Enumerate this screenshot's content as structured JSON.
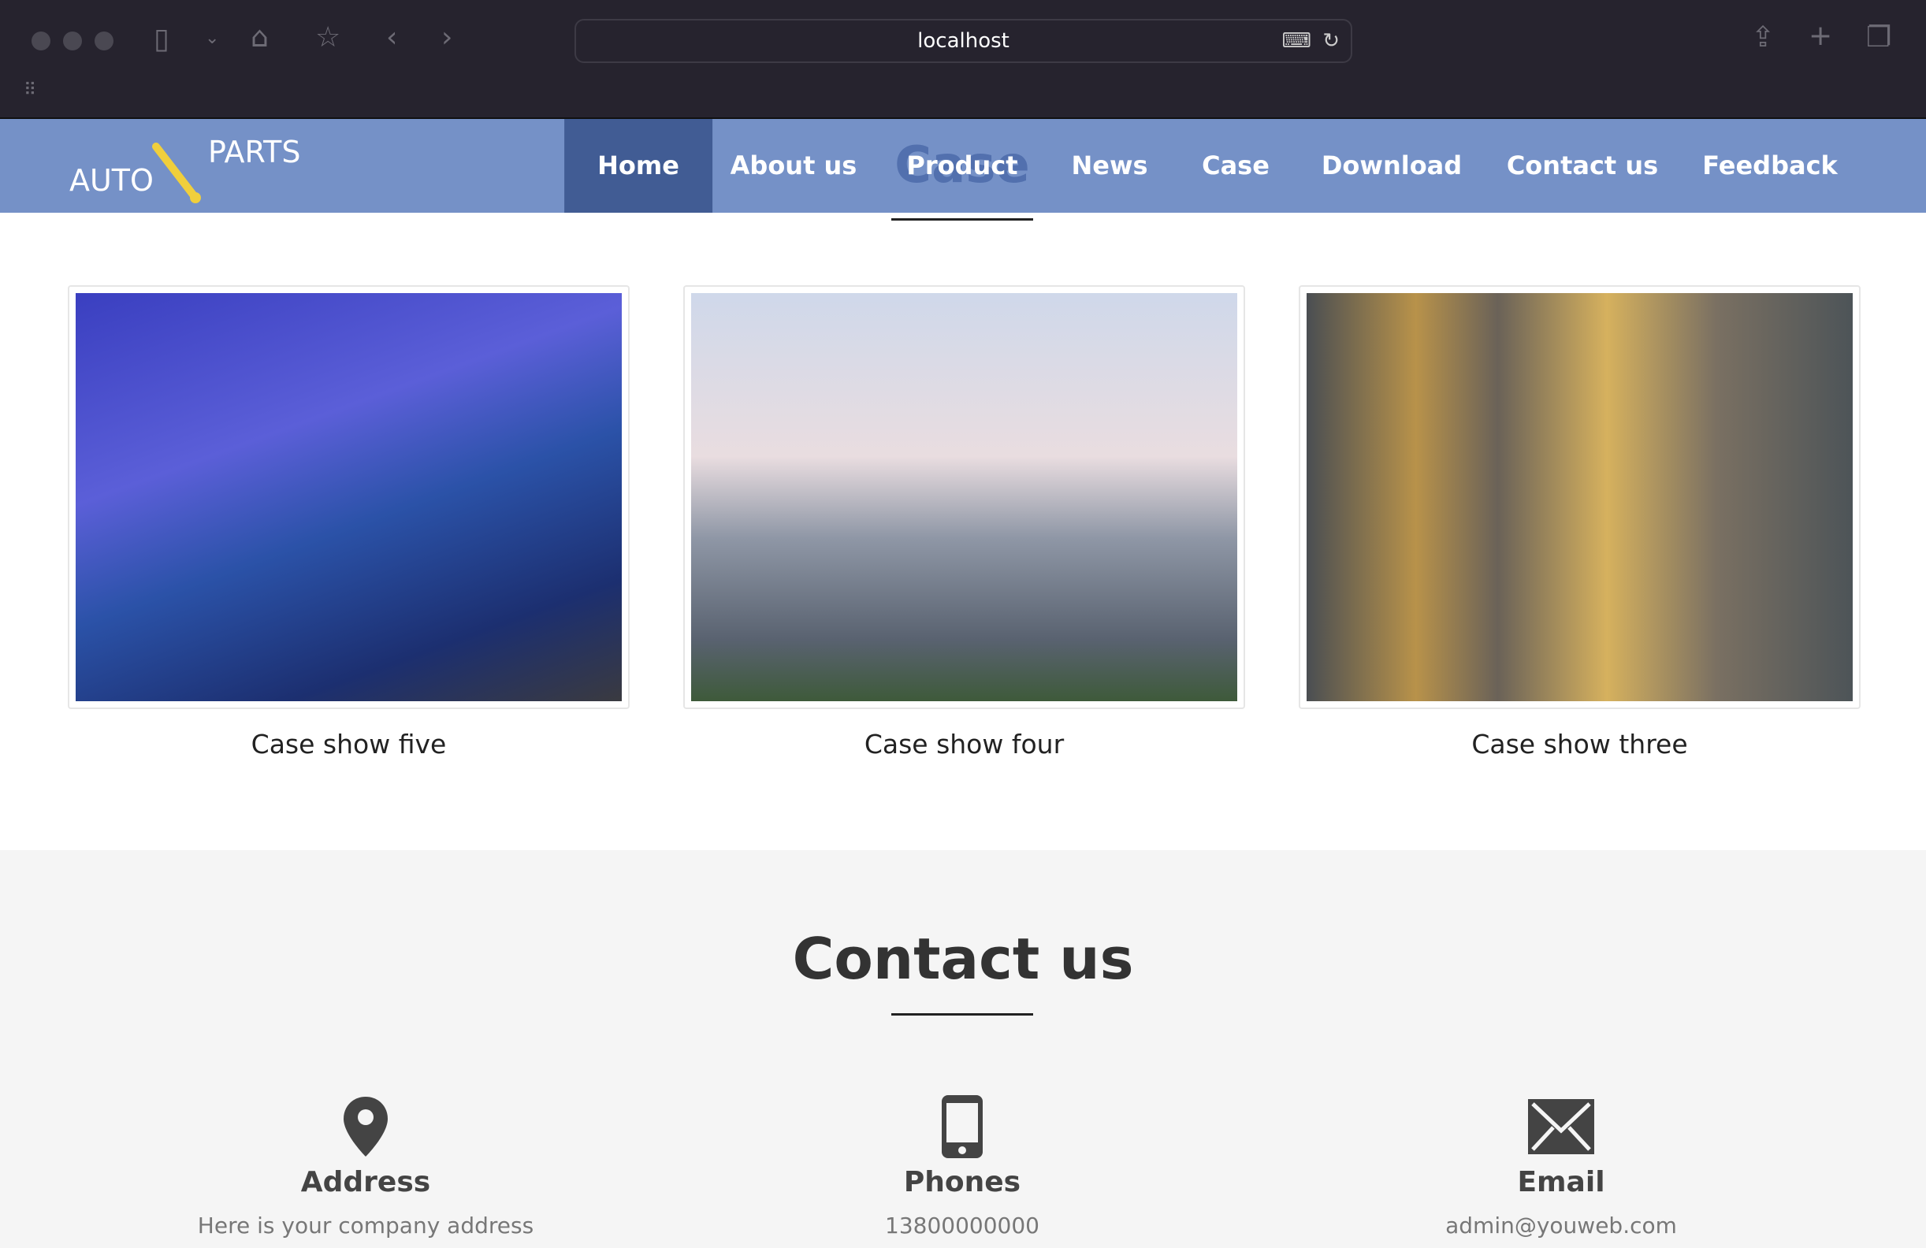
{
  "browser": {
    "url": "localhost"
  },
  "nav": {
    "logo": {
      "left": "AUTO",
      "right": "PARTS"
    },
    "items": [
      "Home",
      "About us",
      "Product",
      "News",
      "Case",
      "Download",
      "Contact us",
      "Feedback"
    ],
    "active": "Home",
    "section_heading": "Case",
    "colors": {
      "bar": "#7591c7",
      "active": "#415c94"
    }
  },
  "cases": [
    {
      "caption": "Case show five"
    },
    {
      "caption": "Case show four"
    },
    {
      "caption": "Case show three"
    }
  ],
  "contact": {
    "title": "Contact us",
    "columns": [
      {
        "icon": "map-pin-icon",
        "label": "Address",
        "text": "Here is your company address"
      },
      {
        "icon": "phone-icon",
        "label": "Phones",
        "text": "13800000000"
      },
      {
        "icon": "envelope-icon",
        "label": "Email",
        "text": "admin@youweb.com"
      }
    ]
  }
}
